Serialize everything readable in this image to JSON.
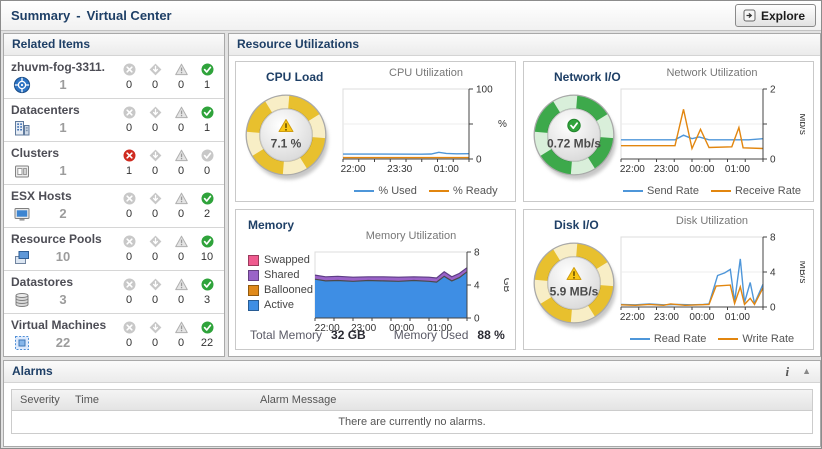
{
  "header": {
    "title": "Summary",
    "separator": "-",
    "subtitle": "Virtual Center",
    "explore_label": "Explore"
  },
  "related_items": {
    "title": "Related Items",
    "rows": [
      {
        "name": "zhuvm-fog-3311.",
        "icon": "vcenter",
        "count": "1",
        "statuses": [
          {
            "type": "fatal",
            "count": "0",
            "active": false
          },
          {
            "type": "critical",
            "count": "0",
            "active": false
          },
          {
            "type": "warning",
            "count": "0",
            "active": false
          },
          {
            "type": "normal",
            "count": "1",
            "active": true
          }
        ]
      },
      {
        "name": "Datacenters",
        "icon": "datacenter",
        "count": "1",
        "statuses": [
          {
            "type": "fatal",
            "count": "0",
            "active": false
          },
          {
            "type": "critical",
            "count": "0",
            "active": false
          },
          {
            "type": "warning",
            "count": "0",
            "active": false
          },
          {
            "type": "normal",
            "count": "1",
            "active": true
          }
        ]
      },
      {
        "name": "Clusters",
        "icon": "cluster",
        "count": "1",
        "statuses": [
          {
            "type": "fatal",
            "count": "1",
            "active": true
          },
          {
            "type": "critical",
            "count": "0",
            "active": false
          },
          {
            "type": "warning",
            "count": "0",
            "active": false
          },
          {
            "type": "normal",
            "count": "0",
            "active": false
          }
        ]
      },
      {
        "name": "ESX Hosts",
        "icon": "host",
        "count": "2",
        "statuses": [
          {
            "type": "fatal",
            "count": "0",
            "active": false
          },
          {
            "type": "critical",
            "count": "0",
            "active": false
          },
          {
            "type": "warning",
            "count": "0",
            "active": false
          },
          {
            "type": "normal",
            "count": "2",
            "active": true
          }
        ]
      },
      {
        "name": "Resource Pools",
        "icon": "pool",
        "count": "10",
        "statuses": [
          {
            "type": "fatal",
            "count": "0",
            "active": false
          },
          {
            "type": "critical",
            "count": "0",
            "active": false
          },
          {
            "type": "warning",
            "count": "0",
            "active": false
          },
          {
            "type": "normal",
            "count": "10",
            "active": true
          }
        ]
      },
      {
        "name": "Datastores",
        "icon": "datastore",
        "count": "3",
        "statuses": [
          {
            "type": "fatal",
            "count": "0",
            "active": false
          },
          {
            "type": "critical",
            "count": "0",
            "active": false
          },
          {
            "type": "warning",
            "count": "0",
            "active": false
          },
          {
            "type": "normal",
            "count": "3",
            "active": true
          }
        ]
      },
      {
        "name": "Virtual Machines",
        "icon": "vm",
        "count": "22",
        "statuses": [
          {
            "type": "fatal",
            "count": "0",
            "active": false
          },
          {
            "type": "critical",
            "count": "0",
            "active": false
          },
          {
            "type": "warning",
            "count": "0",
            "active": false
          },
          {
            "type": "normal",
            "count": "22",
            "active": true
          }
        ]
      }
    ]
  },
  "resource_utilizations": {
    "title": "Resource Utilizations",
    "cpu": {
      "title": "CPU Load"
    },
    "network": {
      "title": "Network I/O"
    },
    "memory": {
      "title": "Memory",
      "total_label": "Total Memory",
      "total_value": "32 GB",
      "used_label": "Memory Used",
      "used_value": "88 %"
    },
    "disk": {
      "title": "Disk I/O"
    }
  },
  "gauges": {
    "cpu": {
      "value": "7.1 %",
      "status": "warning"
    },
    "network": {
      "value": "0.72 Mb/s",
      "status": "normal"
    },
    "disk": {
      "value": "5.9 MB/s",
      "status": "warning"
    }
  },
  "charts": {
    "cpu": {
      "type": "line",
      "title": "CPU Utilization",
      "unit": "%",
      "unit_rotated": false,
      "ylim": [
        0,
        100
      ],
      "yticks": [
        {
          "v": 100,
          "label": "100"
        },
        {
          "v": 50,
          "label": ""
        },
        {
          "v": 0,
          "label": "0"
        }
      ],
      "xticks": [
        {
          "pos": 0.08,
          "label": "22:00"
        },
        {
          "pos": 0.45,
          "label": "23:30"
        },
        {
          "pos": 0.82,
          "label": "01:00"
        }
      ],
      "series": [
        {
          "name": "% Used",
          "color": "#4e96d9",
          "points": [
            [
              0,
              7
            ],
            [
              0.3,
              7
            ],
            [
              0.62,
              6.8
            ],
            [
              0.7,
              7.2
            ],
            [
              0.76,
              9.5
            ],
            [
              0.82,
              8
            ],
            [
              0.9,
              7.4
            ],
            [
              1,
              7.6
            ]
          ]
        },
        {
          "name": "% Ready",
          "color": "#e2860f",
          "points": [
            [
              0,
              2
            ],
            [
              0.5,
              2
            ],
            [
              1,
              2
            ]
          ]
        }
      ],
      "legend": [
        {
          "label": "% Used",
          "color": "#4e96d9"
        },
        {
          "label": "% Ready",
          "color": "#e2860f"
        }
      ]
    },
    "network": {
      "type": "line",
      "title": "Network Utilization",
      "unit": "Mb/s",
      "unit_rotated": true,
      "ylim": [
        0,
        2
      ],
      "yticks": [
        {
          "v": 2,
          "label": "2"
        },
        {
          "v": 1,
          "label": ""
        },
        {
          "v": 0,
          "label": "0"
        }
      ],
      "xticks": [
        {
          "pos": 0.08,
          "label": "22:00"
        },
        {
          "pos": 0.32,
          "label": "23:00"
        },
        {
          "pos": 0.57,
          "label": "00:00"
        },
        {
          "pos": 0.82,
          "label": "01:00"
        }
      ],
      "series": [
        {
          "name": "Send Rate",
          "color": "#4e96d9",
          "points": [
            [
              0,
              0.55
            ],
            [
              0.38,
              0.55
            ],
            [
              0.44,
              0.68
            ],
            [
              0.5,
              0.58
            ],
            [
              0.55,
              0.63
            ],
            [
              0.62,
              0.55
            ],
            [
              0.9,
              0.55
            ],
            [
              1,
              0.58
            ]
          ]
        },
        {
          "name": "Receive Rate",
          "color": "#e2860f",
          "points": [
            [
              0,
              0.38
            ],
            [
              0.38,
              0.38
            ],
            [
              0.44,
              1.42
            ],
            [
              0.5,
              0.3
            ],
            [
              0.56,
              0.85
            ],
            [
              0.62,
              0.33
            ],
            [
              0.78,
              0.35
            ],
            [
              0.83,
              0.9
            ],
            [
              0.86,
              0.32
            ],
            [
              1,
              0.3
            ]
          ]
        }
      ],
      "legend": [
        {
          "label": "Send Rate",
          "color": "#4e96d9"
        },
        {
          "label": "Receive Rate",
          "color": "#e2860f"
        }
      ]
    },
    "memory": {
      "type": "area",
      "title": "Memory Utilization",
      "unit": "GB",
      "unit_rotated": true,
      "ylim": [
        0,
        8
      ],
      "yticks": [
        {
          "v": 8,
          "label": "8"
        },
        {
          "v": 4,
          "label": "4"
        },
        {
          "v": 0,
          "label": "0"
        }
      ],
      "xticks": [
        {
          "pos": 0.08,
          "label": "22:00"
        },
        {
          "pos": 0.32,
          "label": "23:00"
        },
        {
          "pos": 0.57,
          "label": "00:00"
        },
        {
          "pos": 0.82,
          "label": "01:00"
        }
      ],
      "areas": [
        {
          "name": "Shared",
          "color": "#9a63c8",
          "line": "#5e3d85",
          "points": [
            [
              0,
              5.2
            ],
            [
              0.07,
              5.0
            ],
            [
              0.15,
              5.05
            ],
            [
              0.25,
              4.95
            ],
            [
              0.35,
              5.0
            ],
            [
              0.45,
              5.0
            ],
            [
              0.55,
              4.95
            ],
            [
              0.65,
              5.0
            ],
            [
              0.75,
              4.95
            ],
            [
              0.8,
              4.85
            ],
            [
              0.85,
              5.6
            ],
            [
              0.9,
              5.0
            ],
            [
              0.95,
              5.4
            ],
            [
              1,
              6.1
            ]
          ]
        },
        {
          "name": "Active",
          "color": "#3e8ee4",
          "line": "#4a4a4a",
          "points": [
            [
              0,
              4.7
            ],
            [
              0.07,
              4.5
            ],
            [
              0.15,
              4.55
            ],
            [
              0.25,
              4.45
            ],
            [
              0.35,
              4.55
            ],
            [
              0.45,
              4.5
            ],
            [
              0.55,
              4.45
            ],
            [
              0.65,
              4.55
            ],
            [
              0.75,
              4.45
            ],
            [
              0.8,
              4.35
            ],
            [
              0.85,
              5.05
            ],
            [
              0.9,
              4.5
            ],
            [
              0.95,
              4.9
            ],
            [
              1,
              5.6
            ]
          ]
        }
      ],
      "legend_v": [
        {
          "label": "Swapped",
          "color": "#ef5b8f"
        },
        {
          "label": "Shared",
          "color": "#9a63c8"
        },
        {
          "label": "Ballooned",
          "color": "#e08a1a"
        },
        {
          "label": "Active",
          "color": "#3e8ee4"
        }
      ]
    },
    "disk": {
      "type": "line",
      "title": "Disk Utilization",
      "unit": "MB/s",
      "unit_rotated": true,
      "ylim": [
        0,
        8
      ],
      "yticks": [
        {
          "v": 8,
          "label": "8"
        },
        {
          "v": 4,
          "label": "4"
        },
        {
          "v": 0,
          "label": "0"
        }
      ],
      "xticks": [
        {
          "pos": 0.08,
          "label": "22:00"
        },
        {
          "pos": 0.32,
          "label": "23:00"
        },
        {
          "pos": 0.57,
          "label": "00:00"
        },
        {
          "pos": 0.82,
          "label": "01:00"
        }
      ],
      "series": [
        {
          "name": "Read Rate",
          "color": "#4e96d9",
          "points": [
            [
              0,
              0.3
            ],
            [
              0.1,
              0.25
            ],
            [
              0.2,
              0.35
            ],
            [
              0.3,
              0.25
            ],
            [
              0.4,
              0.3
            ],
            [
              0.5,
              0.25
            ],
            [
              0.58,
              0.3
            ],
            [
              0.62,
              0.35
            ],
            [
              0.68,
              3.6
            ],
            [
              0.73,
              3.9
            ],
            [
              0.77,
              4.3
            ],
            [
              0.8,
              0.6
            ],
            [
              0.84,
              5.5
            ],
            [
              0.87,
              0.5
            ],
            [
              0.91,
              2.8
            ],
            [
              0.94,
              0.4
            ],
            [
              1,
              2.6
            ]
          ]
        },
        {
          "name": "Write Rate",
          "color": "#e2860f",
          "points": [
            [
              0,
              0.25
            ],
            [
              0.1,
              0.2
            ],
            [
              0.2,
              0.3
            ],
            [
              0.3,
              0.2
            ],
            [
              0.35,
              0.35
            ],
            [
              0.45,
              0.2
            ],
            [
              0.55,
              0.25
            ],
            [
              0.62,
              0.3
            ],
            [
              0.67,
              2.4
            ],
            [
              0.77,
              2.5
            ],
            [
              0.8,
              0.4
            ],
            [
              0.84,
              2.3
            ],
            [
              0.87,
              0.3
            ],
            [
              0.91,
              1.0
            ],
            [
              0.94,
              0.3
            ],
            [
              1,
              2.2
            ]
          ]
        }
      ],
      "legend": [
        {
          "label": "Read Rate",
          "color": "#4e96d9"
        },
        {
          "label": "Write Rate",
          "color": "#e2860f"
        }
      ]
    }
  },
  "alarms": {
    "title": "Alarms",
    "columns": [
      "Severity",
      "Time",
      "Alarm Message"
    ],
    "empty_message": "There are currently no alarms.",
    "info_icon": "i",
    "collapse_icon": "▲"
  }
}
